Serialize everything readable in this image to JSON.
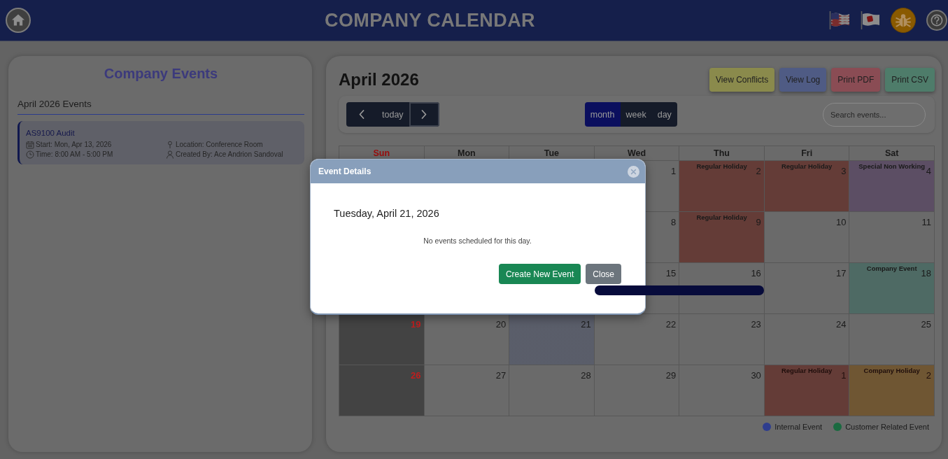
{
  "header": {
    "title": "COMPANY CALENDAR"
  },
  "events_panel": {
    "title": "Company Events",
    "section": "April 2026 Events",
    "events": [
      {
        "title": "AS9100 Audit",
        "start": "Start: Mon, Apr 13, 2026",
        "location": "Location: Conference Room",
        "time": "Time: 8:00 AM - 5:00 PM",
        "created_by": "Created By: Ace Andrion Sandoval"
      }
    ]
  },
  "calendar": {
    "title": "April 2026",
    "actions": [
      {
        "label": "View Conflicts",
        "color": "#8a8a4c"
      },
      {
        "label": "View Log",
        "color": "#4f5b84"
      },
      {
        "label": "Print PDF",
        "color": "#8a4c54"
      },
      {
        "label": "Print CSV",
        "color": "#4e7c6a"
      }
    ],
    "nav": {
      "today": "today",
      "next_focused": true
    },
    "views": [
      {
        "label": "month",
        "selected": true
      },
      {
        "label": "week",
        "selected": false
      },
      {
        "label": "day",
        "selected": false
      }
    ],
    "search": {
      "placeholder": "Search events..."
    },
    "weekdays": [
      {
        "label": "Sun",
        "rest_day": true
      },
      {
        "label": "Mon",
        "rest_day": false
      },
      {
        "label": "Tue",
        "rest_day": false
      },
      {
        "label": "Wed",
        "rest_day": false
      },
      {
        "label": "Thu",
        "rest_day": false
      },
      {
        "label": "Fri",
        "rest_day": false
      },
      {
        "label": "Sat",
        "rest_day": false
      }
    ],
    "weeks": [
      {
        "cells": [
          {
            "day": "1",
            "selected": false,
            "outside": false
          },
          {
            "day": "2",
            "label": "Regular Holiday",
            "color": "#643c37",
            "selected": false,
            "outside": false
          },
          {
            "day": "3",
            "label": "Regular Holiday",
            "color": "#643c37",
            "selected": false,
            "outside": false
          },
          {
            "day": "4",
            "label": "Special Non Working",
            "color": "#5c4e64",
            "selected": false,
            "outside": false
          }
        ]
      },
      {
        "cells": [
          {
            "day": "8",
            "selected": false,
            "outside": false
          },
          {
            "day": "9",
            "label": "Regular Holiday",
            "color": "#643c37",
            "selected": false,
            "outside": false
          },
          {
            "day": "10",
            "selected": false,
            "outside": false
          },
          {
            "day": "11",
            "selected": false,
            "outside": false
          }
        ]
      },
      {
        "cells": [
          {
            "day": "15",
            "bar": true,
            "selected": false,
            "outside": false
          },
          {
            "day": "16",
            "bar": true,
            "selected": false,
            "outside": false
          },
          {
            "day": "17",
            "selected": false,
            "outside": false
          },
          {
            "day": "18",
            "label": "Company Event",
            "color": "#4e6a64",
            "selected": false,
            "outside": false
          }
        ]
      },
      {
        "cells": [
          {
            "day": "19",
            "selected": false,
            "outside": false
          },
          {
            "day": "20",
            "selected": false,
            "outside": false
          },
          {
            "day": "21",
            "selected": true,
            "outside": false
          },
          {
            "day": "22",
            "selected": false,
            "outside": false
          },
          {
            "day": "23",
            "selected": false,
            "outside": false
          },
          {
            "day": "24",
            "selected": false,
            "outside": false
          },
          {
            "day": "25",
            "selected": false,
            "outside": false
          }
        ]
      },
      {
        "cells": [
          {
            "day": "26",
            "selected": false,
            "outside": false
          },
          {
            "day": "27",
            "selected": false,
            "outside": false
          },
          {
            "day": "28",
            "selected": false,
            "outside": false
          },
          {
            "day": "29",
            "selected": false,
            "outside": false
          },
          {
            "day": "30",
            "selected": false,
            "outside": false
          },
          {
            "day": "1",
            "label": "Regular Holiday",
            "color": "#643c37",
            "selected": false,
            "outside": true
          },
          {
            "day": "2",
            "label": "Company Holiday",
            "color": "#6f5633",
            "selected": false,
            "outside": true
          }
        ]
      }
    ],
    "legend": [
      {
        "label": "Internal Event",
        "color": "#2e3d8e"
      },
      {
        "label": "Customer Related Event",
        "color": "#1a6a40"
      }
    ]
  },
  "dialog": {
    "title": "Event Details",
    "date": "Tuesday, April 21, 2026",
    "message": "No events scheduled for this day.",
    "buttons": [
      {
        "label": "Create New Event",
        "kind": "primary"
      },
      {
        "label": "Close",
        "kind": "secondary"
      }
    ]
  }
}
